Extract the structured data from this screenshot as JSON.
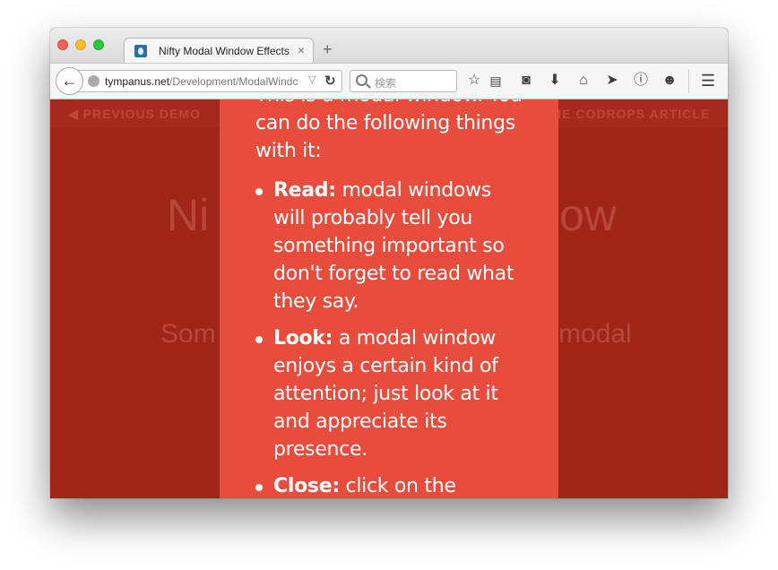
{
  "browser": {
    "tab_title": "Nifty Modal Window Effects",
    "tab_close": "×",
    "new_tab": "+",
    "url_host": "tympanus.net",
    "url_path": "/Development/ModalWindc",
    "search_placeholder": "検索",
    "icons": [
      "back-icon",
      "globe-icon",
      "reload-icon",
      "search-icon",
      "bookmark-star-icon",
      "reading-list-icon",
      "pocket-icon",
      "download-icon",
      "home-icon",
      "send-icon",
      "info-icon",
      "smiley-icon",
      "menu-icon"
    ]
  },
  "background": {
    "prev_demo": "◀ PREVIOUS DEMO",
    "article_link": "HE CODROPS ARTICLE",
    "title_left": "Ni",
    "title_right": "ow",
    "subtitle_left": "Som",
    "subtitle_right": "modal"
  },
  "modal": {
    "intro": "This is a modal window. You can do the following things with it:",
    "items": [
      {
        "label": "Read:",
        "text": " modal windows will probably tell you something important so don't forget to read what they say."
      },
      {
        "label": "Look:",
        "text": " a modal window enjoys a certain kind of attention; just look at it and appreciate its presence."
      },
      {
        "label": "Close:",
        "text": " click on the button"
      }
    ]
  },
  "colors": {
    "overlay": "#9e2518",
    "modal": "#e74c3c",
    "text": "#ffffff"
  }
}
